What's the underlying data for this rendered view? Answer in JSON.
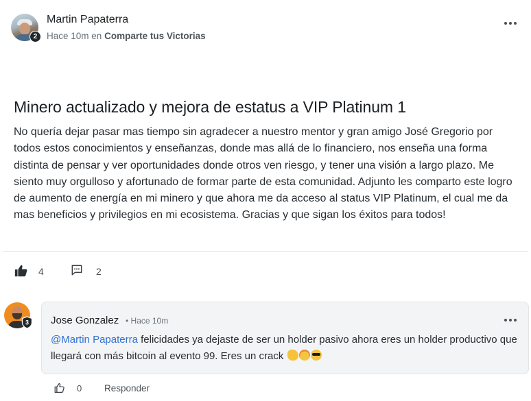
{
  "post": {
    "author": {
      "name": "Martin Papaterra",
      "level": "2"
    },
    "time": "Hace 10m",
    "in_label": "en",
    "community": "Comparte tus Victorias",
    "title": "Minero actualizado y mejora de estatus a VIP Platinum 1",
    "body": "No quería dejar pasar mas tiempo sin agradecer a nuestro mentor y gran amigo José Gregorio por todos estos conocimientos y enseñanzas, donde mas allá de lo financiero, nos enseña una forma distinta de pensar y ver oportunidades donde otros ven riesgo, y tener una visión a largo plazo. Me siento muy orgulloso y afortunado de formar parte de esta comunidad. Adjunto les comparto este logro de aumento de energía en mi minero y que ahora me da acceso al status VIP Platinum, el cual me da mas beneficios y privilegios en mi ecosistema. Gracias y que sigan los éxitos para todos!",
    "likes": "4",
    "comments": "2"
  },
  "comment": {
    "author": {
      "name": "Jose Gonzalez",
      "level": "3"
    },
    "time": "• Hace 10m",
    "mention": "@Martin Papaterra",
    "text": " felicidades ya dejaste de ser un holder pasivo ahora eres un holder productivo que llegará con más bitcoin al evento 99. Eres un crack ",
    "emojis": [
      "flexed-biceps",
      "exploding-head",
      "sunglasses-face"
    ],
    "likes": "0",
    "reply_label": "Responder"
  },
  "colors": {
    "mention": "#2f6fd6",
    "comment_bg": "#f3f4f5",
    "avatar_orange": "#f08c1e"
  }
}
